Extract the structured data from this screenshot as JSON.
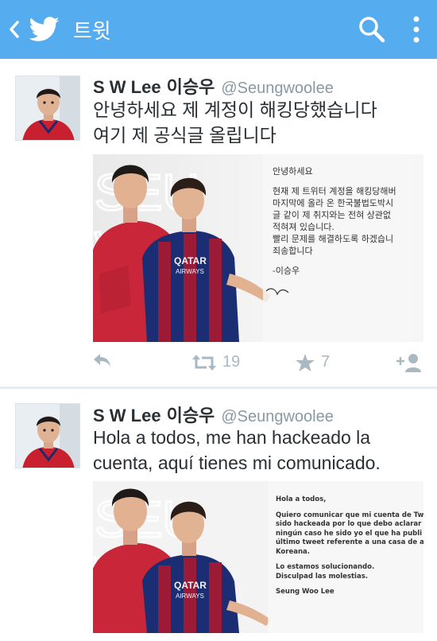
{
  "topbar": {
    "title": "트윗",
    "icons": [
      "back-arrow-icon",
      "twitter-bird-icon",
      "search-icon",
      "more-vertical-icon"
    ],
    "color": "#55acee"
  },
  "tweets": [
    {
      "name": "S W Lee",
      "name_ko": "이승우",
      "handle": "@Seungwoolee",
      "lines": [
        "안녕하세요 제 계정이 해킹당했습니다",
        "여기 제 공식글 올립니다"
      ],
      "image": {
        "watermark": "SEUNG WOO LEE",
        "jersey_text": "QATAR AIRWAYS",
        "letter": [
          "안녕하세요",
          "",
          "현재 제 트위터 계정을 해킹당해버",
          "마지막에 올라 온 한국불법도박시",
          "글 같이 제 취지와는 전혀 상관없",
          "적혀져 있습니다.",
          "빨리 문제를 해결하도록 하겠습니",
          "죄송합니다",
          "",
          "-이승우"
        ]
      },
      "actions": {
        "retweets": "19",
        "favorites": "7"
      }
    },
    {
      "name": "S W Lee",
      "name_ko": "이승우",
      "handle": "@Seungwoolee",
      "lines": [
        "Hola a todos, me han hackeado la",
        "cuenta, aquí tienes mi comunicado."
      ],
      "image": {
        "watermark": "SEUNG WOO LEE",
        "jersey_text": "QATAR AIRWAYS",
        "letter": [
          "Hola a todos,",
          "",
          "Quiero comunicar que mi cuenta de Tw",
          "sido hackeada por lo que debo aclarar",
          "ningún caso he sido yo el que ha publi",
          "último tweet referente a una casa de a",
          "Koreana.",
          "",
          "Lo estamos solucionando.",
          "Disculpad las molestias.",
          "",
          "Seung Woo Lee"
        ]
      }
    }
  ]
}
